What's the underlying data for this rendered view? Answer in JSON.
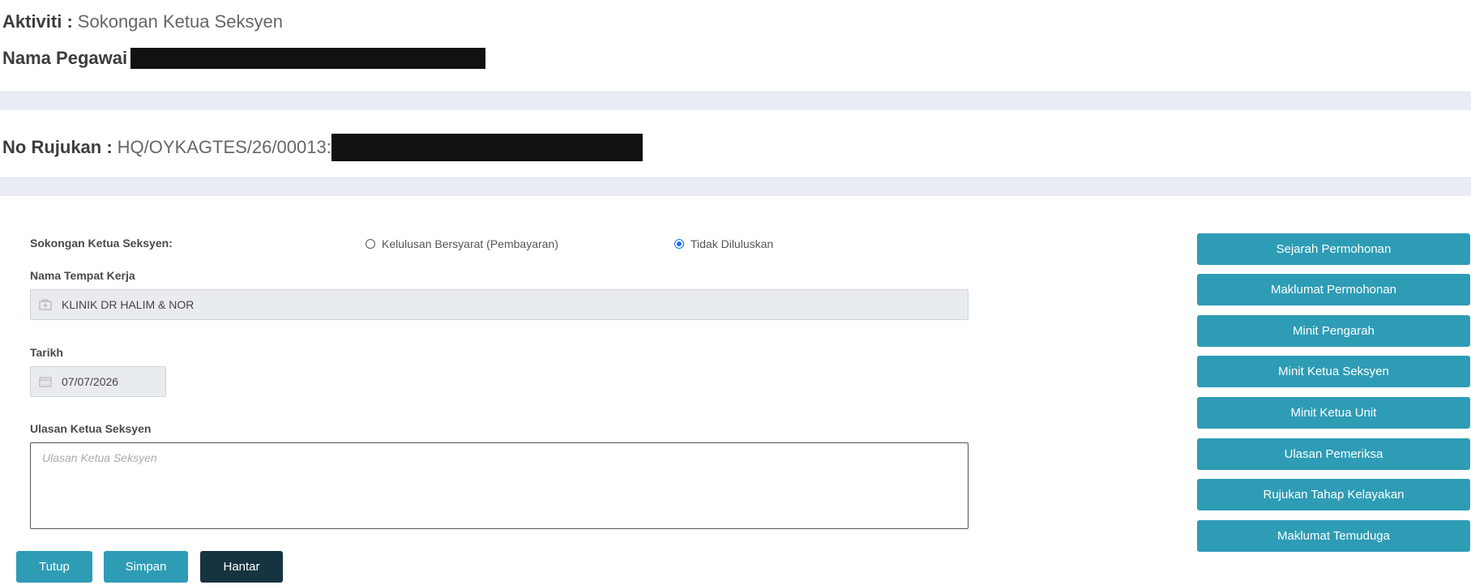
{
  "header": {
    "activity_label": "Aktiviti :",
    "activity_value": "Sokongan Ketua Seksyen",
    "officer_label": "Nama Pegawai",
    "reference_label": "No Rujukan :",
    "reference_value": "HQ/OYKAGTES/26/00013:"
  },
  "form": {
    "support_label": "Sokongan Ketua Seksyen:",
    "radio_options": [
      {
        "label": "Kelulusan Bersyarat (Pembayaran)",
        "checked": false
      },
      {
        "label": "Tidak Diluluskan",
        "checked": true
      }
    ],
    "workplace_label": "Nama Tempat Kerja",
    "workplace_value": "KLINIK DR HALIM & NOR",
    "date_label": "Tarikh",
    "date_value": "07/07/2026",
    "comment_label": "Ulasan Ketua Seksyen",
    "comment_placeholder": "Ulasan Ketua Seksyen"
  },
  "actions": {
    "close": "Tutup",
    "save": "Simpan",
    "submit": "Hantar"
  },
  "side_buttons": [
    "Sejarah Permohonan",
    "Maklumat Permohonan",
    "Minit Pengarah",
    "Minit Ketua Seksyen",
    "Minit Ketua Unit",
    "Ulasan Pemeriksa",
    "Rujukan Tahap Kelayakan",
    "Maklumat Temuduga"
  ],
  "colors": {
    "accent": "#2e9cb5",
    "submit": "#163440",
    "band": "#e9ecf4",
    "radio_selected": "#1a73e8"
  }
}
